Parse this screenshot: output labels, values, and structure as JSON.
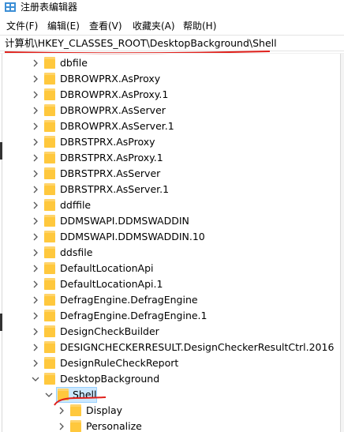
{
  "window": {
    "title": "注册表编辑器",
    "icon": "registry-editor-icon"
  },
  "menu": [
    "文件(F)",
    "编辑(E)",
    "查看(V)",
    "收藏夹(A)",
    "帮助(H)"
  ],
  "address": {
    "path": "计算机\\HKEY_CLASSES_ROOT\\DesktopBackground\\Shell"
  },
  "tree": {
    "items": [
      {
        "label": "dbfile",
        "level": 0,
        "expanded": false
      },
      {
        "label": "DBROWPRX.AsProxy",
        "level": 0,
        "expanded": false
      },
      {
        "label": "DBROWPRX.AsProxy.1",
        "level": 0,
        "expanded": false
      },
      {
        "label": "DBROWPRX.AsServer",
        "level": 0,
        "expanded": false
      },
      {
        "label": "DBROWPRX.AsServer.1",
        "level": 0,
        "expanded": false
      },
      {
        "label": "DBRSTPRX.AsProxy",
        "level": 0,
        "expanded": false
      },
      {
        "label": "DBRSTPRX.AsProxy.1",
        "level": 0,
        "expanded": false
      },
      {
        "label": "DBRSTPRX.AsServer",
        "level": 0,
        "expanded": false
      },
      {
        "label": "DBRSTPRX.AsServer.1",
        "level": 0,
        "expanded": false
      },
      {
        "label": "ddffile",
        "level": 0,
        "expanded": false
      },
      {
        "label": "DDMSWAPI.DDMSWADDIN",
        "level": 0,
        "expanded": false
      },
      {
        "label": "DDMSWAPI.DDMSWADDIN.10",
        "level": 0,
        "expanded": false
      },
      {
        "label": "ddsfile",
        "level": 0,
        "expanded": false
      },
      {
        "label": "DefaultLocationApi",
        "level": 0,
        "expanded": false
      },
      {
        "label": "DefaultLocationApi.1",
        "level": 0,
        "expanded": false
      },
      {
        "label": "DefragEngine.DefragEngine",
        "level": 0,
        "expanded": false
      },
      {
        "label": "DefragEngine.DefragEngine.1",
        "level": 0,
        "expanded": false
      },
      {
        "label": "DesignCheckBuilder",
        "level": 0,
        "expanded": false
      },
      {
        "label": "DESIGNCHECKERRESULT.DesignCheckerResultCtrl.2016",
        "level": 0,
        "expanded": false
      },
      {
        "label": "DesignRuleCheckReport",
        "level": 0,
        "expanded": false
      },
      {
        "label": "DesktopBackground",
        "level": 0,
        "expanded": true
      },
      {
        "label": "Shell",
        "level": 1,
        "expanded": true,
        "selected": true
      },
      {
        "label": "Display",
        "level": 2,
        "expanded": false
      },
      {
        "label": "Personalize",
        "level": 2,
        "expanded": false
      }
    ]
  },
  "colors": {
    "folder": "#ffc83d",
    "selection": "#cce8ff",
    "annotation_red": "#e0201b"
  }
}
